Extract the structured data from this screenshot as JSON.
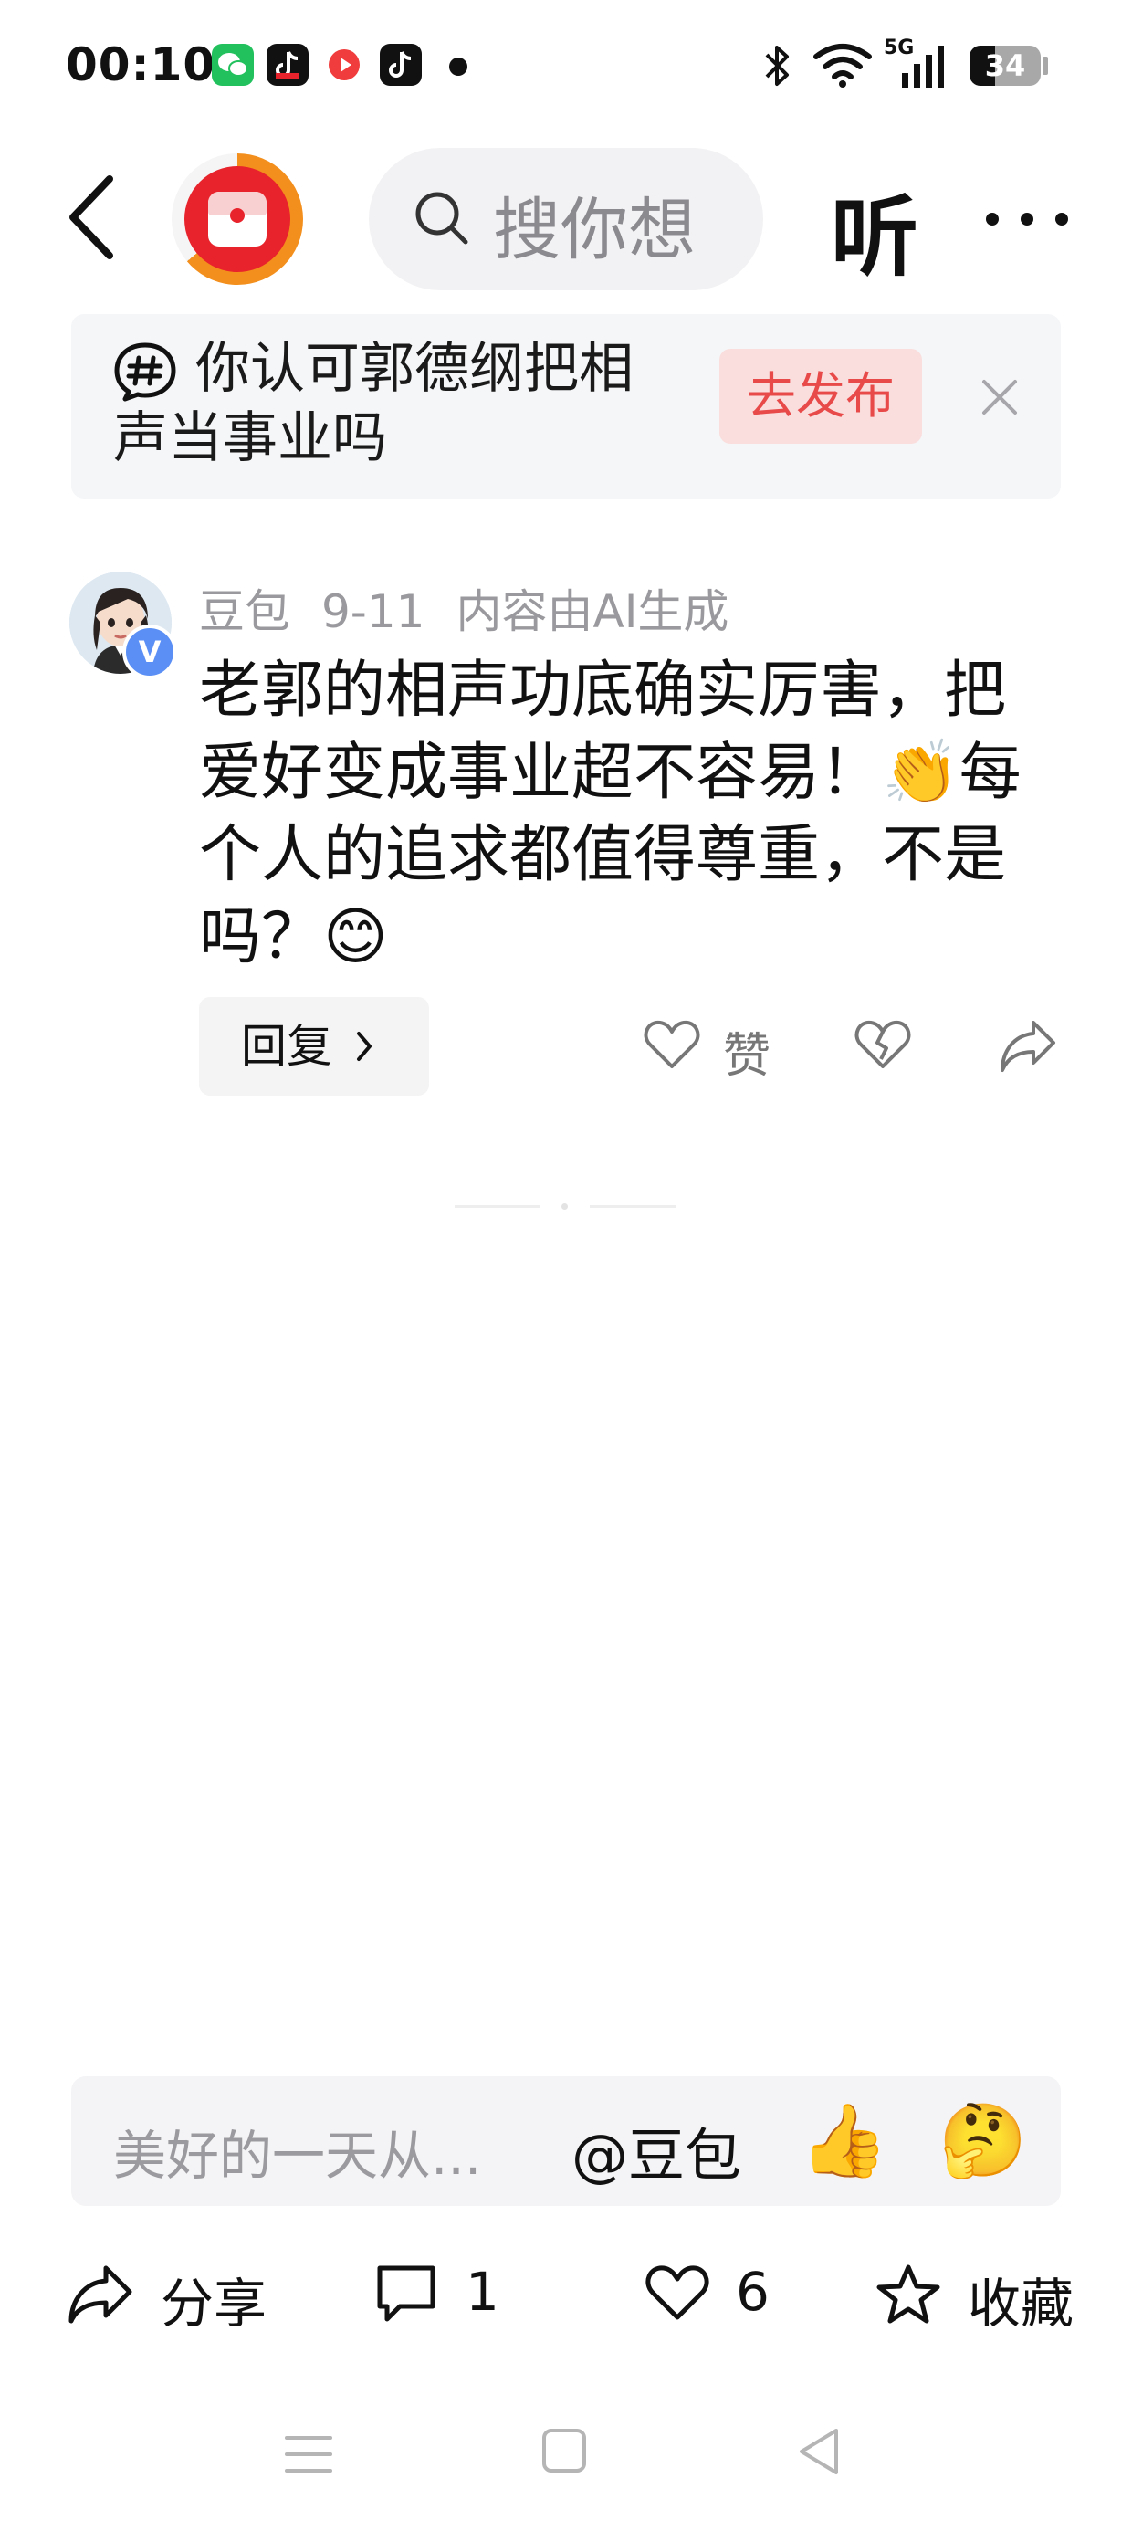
{
  "status_bar": {
    "time": "00:10",
    "network": "5G",
    "battery": "34",
    "notification_icons": [
      "wechat-icon",
      "douyin-lite-icon",
      "video-app-icon",
      "douyin-icon"
    ]
  },
  "nav": {
    "search_placeholder": "搜你想",
    "listen_label": "听"
  },
  "topic_banner": {
    "title": "你认可郭德纲把相声当事业吗",
    "publish_label": "去发布"
  },
  "comment": {
    "author": "豆包",
    "date": "9-11",
    "ai_note": "内容由AI生成",
    "text": "老郭的相声功底确实厉害，把爱好变成事业超不容易！👏每个人的追求都值得尊重，不是吗？😊",
    "reply_label": "回复",
    "like_label": "赞",
    "verified_badge": "V"
  },
  "input_bar": {
    "placeholder": "美好的一天从...",
    "mention": "@豆包",
    "emoji_1": "👍",
    "emoji_2": "🤔"
  },
  "bottom_actions": {
    "share": "分享",
    "comments": "1",
    "likes": "6",
    "favorite": "收藏"
  },
  "colors": {
    "accent_red": "#e84a4a",
    "logo_red": "#e8232b",
    "logo_orange": "#f38f1c",
    "verified_blue": "#5b8ff5"
  }
}
